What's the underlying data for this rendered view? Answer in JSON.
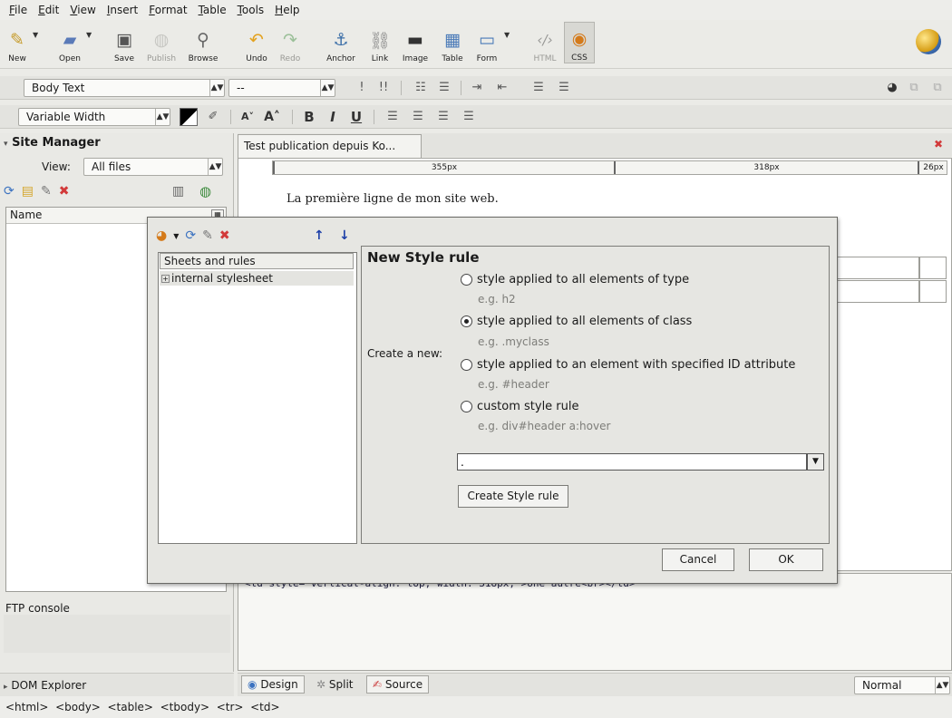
{
  "menu": [
    "File",
    "Edit",
    "View",
    "Insert",
    "Format",
    "Table",
    "Tools",
    "Help"
  ],
  "toolbar": {
    "new": "New",
    "open": "Open",
    "save": "Save",
    "publish": "Publish",
    "browse": "Browse",
    "undo": "Undo",
    "redo": "Redo",
    "anchor": "Anchor",
    "link": "Link",
    "image": "Image",
    "table": "Table",
    "form": "Form",
    "html": "HTML",
    "css": "CSS"
  },
  "format": {
    "paragraph_style": "Body Text",
    "class_combo": "--",
    "font_combo": "Variable Width"
  },
  "site_manager": {
    "title": "Site Manager",
    "view_label": "View:",
    "view_value": "All files",
    "name_column": "Name"
  },
  "editor": {
    "tab_title": "Test publication depuis Ko...",
    "ruler": [
      "355px",
      "318px",
      "26px"
    ],
    "first_line": "La première ligne de mon site web.",
    "source_line": "<td style=\"vertical-align: top; width: 318px;\">Une autre<br></td>"
  },
  "bottom": {
    "ftp_console": "FTP console",
    "dom_explorer": "DOM Explorer",
    "view_design": "Design",
    "view_split": "Split",
    "view_source": "Source",
    "mode": "Normal"
  },
  "status": {
    "breadcrumb": "<html>  <body>  <table>  <tbody>  <tr>  <td>"
  },
  "dialog": {
    "tree_header": "Sheets and rules",
    "tree_item": "internal stylesheet",
    "title": "New Style rule",
    "create_label": "Create a new:",
    "options": [
      {
        "label": "style applied to all elements of type",
        "example": "e.g. h2",
        "selected": false
      },
      {
        "label": "style applied to all elements of class",
        "example": "e.g. .myclass",
        "selected": true
      },
      {
        "label": "style applied to an element with specified ID attribute",
        "example": "e.g. #header",
        "selected": false
      },
      {
        "label": "custom style rule",
        "example": "e.g. div#header a:hover",
        "selected": false
      }
    ],
    "rule_value": ".",
    "create_button": "Create Style rule",
    "cancel": "Cancel",
    "ok": "OK"
  },
  "colors": {
    "up_arrow": "#1c3fa8",
    "delete_x": "#d23a3a",
    "selected_item_bg": "#e4e4e0"
  }
}
